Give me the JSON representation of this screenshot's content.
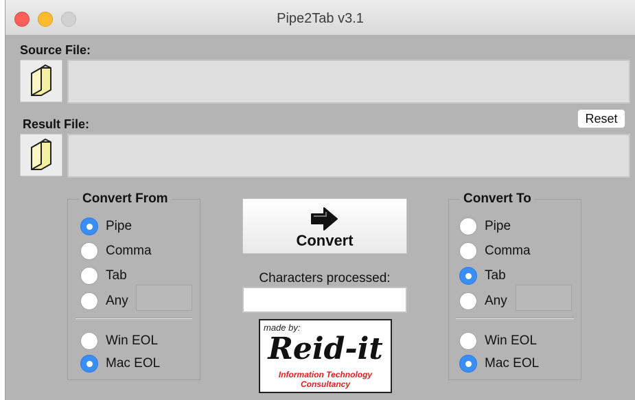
{
  "window": {
    "title": "Pipe2Tab v3.1"
  },
  "source": {
    "label": "Source File:",
    "path": ""
  },
  "result": {
    "label": "Result File:",
    "path": "",
    "reset_label": "Reset"
  },
  "convert_from": {
    "title": "Convert From",
    "options": [
      {
        "label": "Pipe",
        "selected": true
      },
      {
        "label": "Comma",
        "selected": false
      },
      {
        "label": "Tab",
        "selected": false
      },
      {
        "label": "Any",
        "selected": false
      }
    ],
    "any_value": "",
    "eol": [
      {
        "label": "Win EOL",
        "selected": false
      },
      {
        "label": "Mac EOL",
        "selected": true
      }
    ]
  },
  "convert_to": {
    "title": "Convert To",
    "options": [
      {
        "label": "Pipe",
        "selected": false
      },
      {
        "label": "Comma",
        "selected": false
      },
      {
        "label": "Tab",
        "selected": true
      },
      {
        "label": "Any",
        "selected": false
      }
    ],
    "any_value": "",
    "eol": [
      {
        "label": "Win EOL",
        "selected": false
      },
      {
        "label": "Mac EOL",
        "selected": true
      }
    ]
  },
  "convert": {
    "label": "Convert",
    "icon": "right-arrow-icon"
  },
  "progress": {
    "label": "Characters processed:",
    "value": ""
  },
  "logo": {
    "made_by": "made by:",
    "name": "Reid-it",
    "line1": "Information Technology",
    "line2": "Consultancy"
  },
  "colors": {
    "accent": "#3a8ef6",
    "background": "#b4b4b4"
  }
}
